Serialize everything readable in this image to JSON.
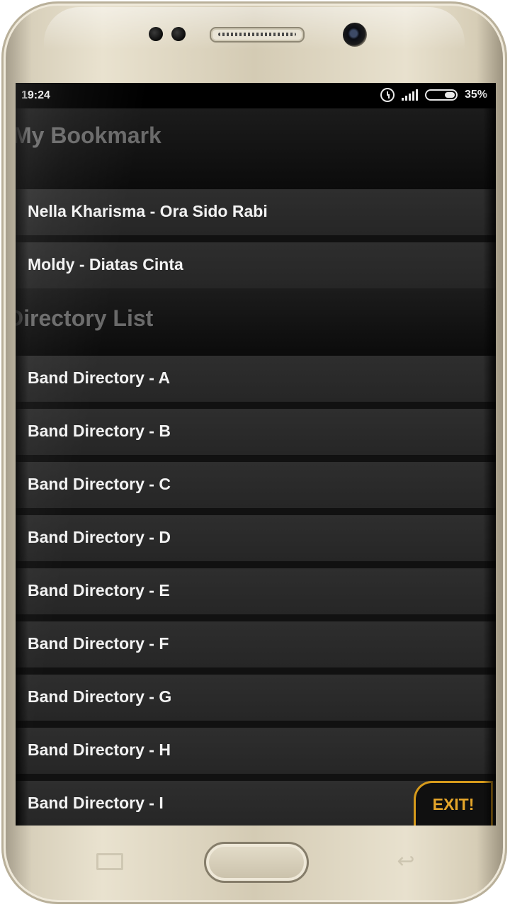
{
  "status_bar": {
    "time": "19:24",
    "battery": "35%"
  },
  "sections": {
    "bookmark_title": "My Bookmark",
    "directory_title": "Directory List"
  },
  "bookmarks": [
    "Nella Kharisma - Ora Sido Rabi",
    "Moldy - Diatas Cinta"
  ],
  "directories": [
    "Band Directory - A",
    "Band Directory - B",
    "Band Directory - C",
    "Band Directory - D",
    "Band Directory - E",
    "Band Directory - F",
    "Band Directory - G",
    "Band Directory - H",
    "Band Directory - I"
  ],
  "exit_label": "EXIT!",
  "colors": {
    "accent": "#e4a52a",
    "row_bg": "#2a2a2a",
    "header_text": "#6a6a6a"
  }
}
